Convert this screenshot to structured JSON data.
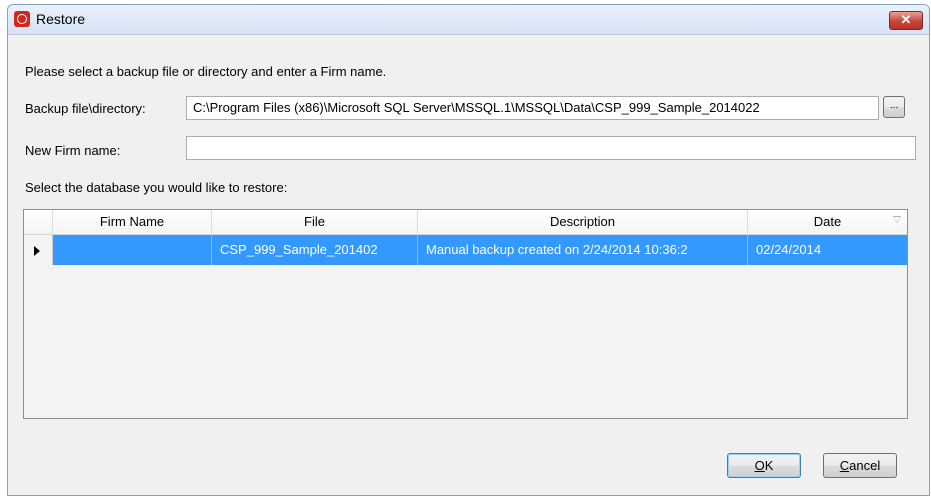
{
  "window": {
    "title": "Restore"
  },
  "prompt": "Please select a backup file or directory and enter a Firm name.",
  "form": {
    "backup_label": "Backup file\\directory:",
    "backup_value": "C:\\Program Files (x86)\\Microsoft SQL Server\\MSSQL.1\\MSSQL\\Data\\CSP_999_Sample_2014022",
    "browse_label": "...",
    "firm_label": "New Firm name:",
    "firm_value": ""
  },
  "db_prompt": "Select the database you would like to restore:",
  "grid": {
    "columns": [
      "Firm Name",
      "File",
      "Description",
      "Date"
    ],
    "rows": [
      {
        "firm_name": "",
        "file": "CSP_999_Sample_201402",
        "description": "Manual backup created on 2/24/2014 10:36:2",
        "date": "02/24/2014"
      }
    ]
  },
  "buttons": {
    "ok_prefix": "O",
    "ok_rest": "K",
    "cancel_prefix": "C",
    "cancel_rest": "ancel"
  },
  "colors": {
    "selection": "#3399ff",
    "close_button": "#c8453a"
  },
  "icons": {
    "app": "restore-app-icon",
    "close": "close-icon",
    "sort": "sort-descending-icon",
    "row": "current-row-arrow-icon"
  }
}
